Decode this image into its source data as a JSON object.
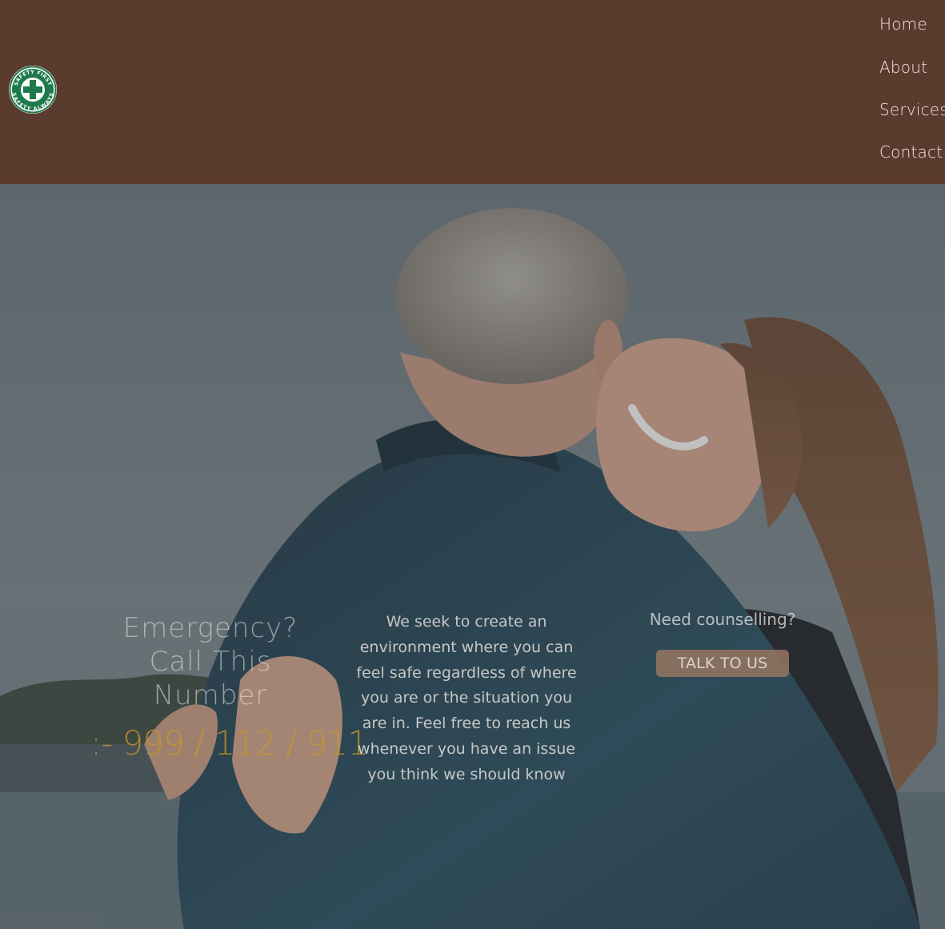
{
  "header": {
    "logo": {
      "icon": "safety-first-badge-icon",
      "text_top": "SAFETY FIRST",
      "text_bottom": "SAFETY ALWAYS",
      "colors": {
        "ring": "#1f7a4a",
        "inner": "#ffffff",
        "cross": "#1f7a4a"
      }
    },
    "nav": [
      {
        "label": "Home"
      },
      {
        "label": "About"
      },
      {
        "label": "Services"
      },
      {
        "label": "Contact"
      }
    ]
  },
  "hero": {
    "image": "couple-embracing-by-lake-photo",
    "emergency": {
      "heading_lines": [
        "Emergency?",
        "Call This",
        "Number"
      ],
      "number": ":- 999 / 112 / 911"
    },
    "mission": "We seek to create an environment where you can feel safe regardless of where you are or the situation you are in. Feel free to reach us whenever you have an issue you think we should know",
    "counsel": {
      "label": "Need counselling?",
      "button": "TALK TO US"
    }
  },
  "colors": {
    "header_bg": "#5b3b2d",
    "nav_text": "#f0e6de",
    "accent_gold": "#c8962a",
    "button_bg": "#96765f"
  }
}
